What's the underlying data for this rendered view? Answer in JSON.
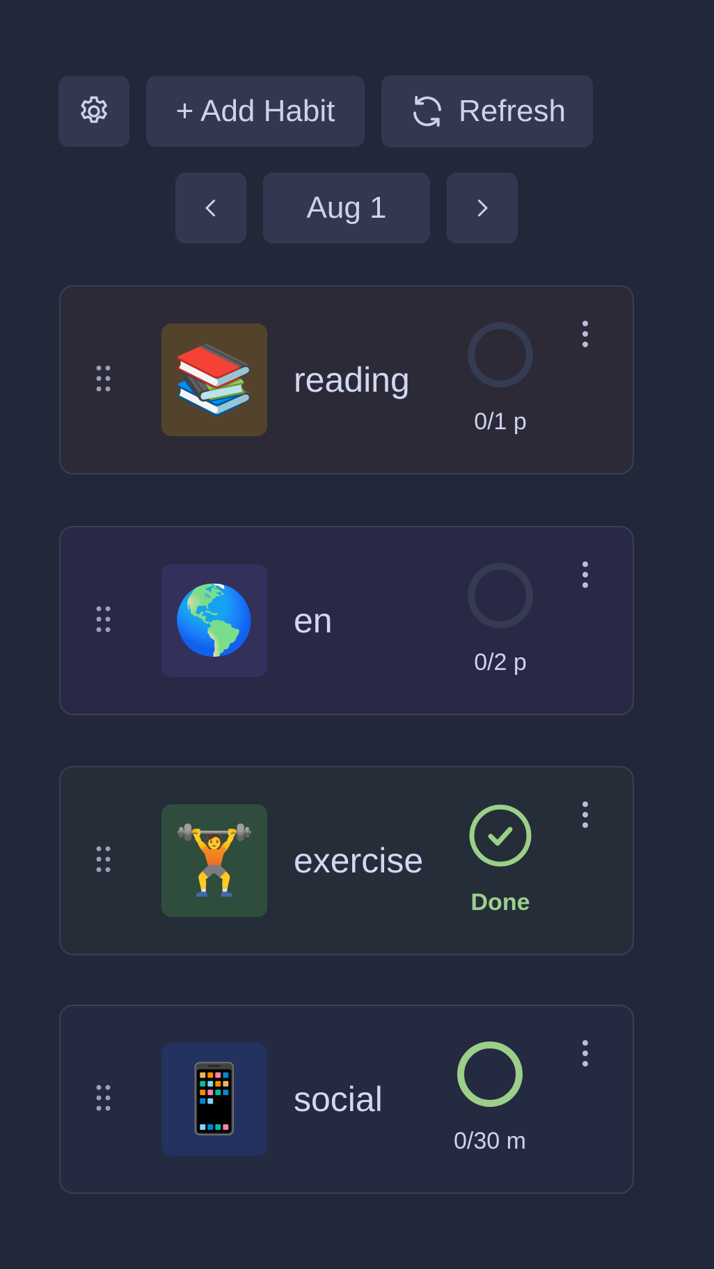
{
  "toolbar": {
    "settings_icon": "gear-icon",
    "add_label": "+ Add Habit",
    "refresh_label": "Refresh",
    "refresh_icon": "refresh-icon"
  },
  "date_nav": {
    "prev_icon": "chevron-left-icon",
    "date_label": "Aug 1",
    "next_icon": "chevron-right-icon"
  },
  "colors": {
    "background": "#23273a",
    "button": "#323850",
    "done": "#9ccf8a",
    "ring_empty": "#353b52"
  },
  "habits": [
    {
      "name": "reading",
      "emoji": "📚",
      "progress_text": "0/1 p",
      "progress": 0,
      "status": "in-progress",
      "card_bg": "#2b2a36",
      "tile_bg": "#54432c"
    },
    {
      "name": "en",
      "emoji": "🌎",
      "progress_text": "0/2 p",
      "progress": 0,
      "status": "in-progress",
      "card_bg": "#292945",
      "tile_bg": "#33305c"
    },
    {
      "name": "exercise",
      "emoji": "🏋️",
      "progress_text": "Done",
      "progress": 1,
      "status": "done",
      "card_bg": "#252d38",
      "tile_bg": "#2f4d3d"
    },
    {
      "name": "social",
      "emoji": "📱",
      "progress_text": "0/30 m",
      "progress": 0,
      "status": "limit",
      "card_bg": "#242a40",
      "tile_bg": "#23325e"
    }
  ]
}
